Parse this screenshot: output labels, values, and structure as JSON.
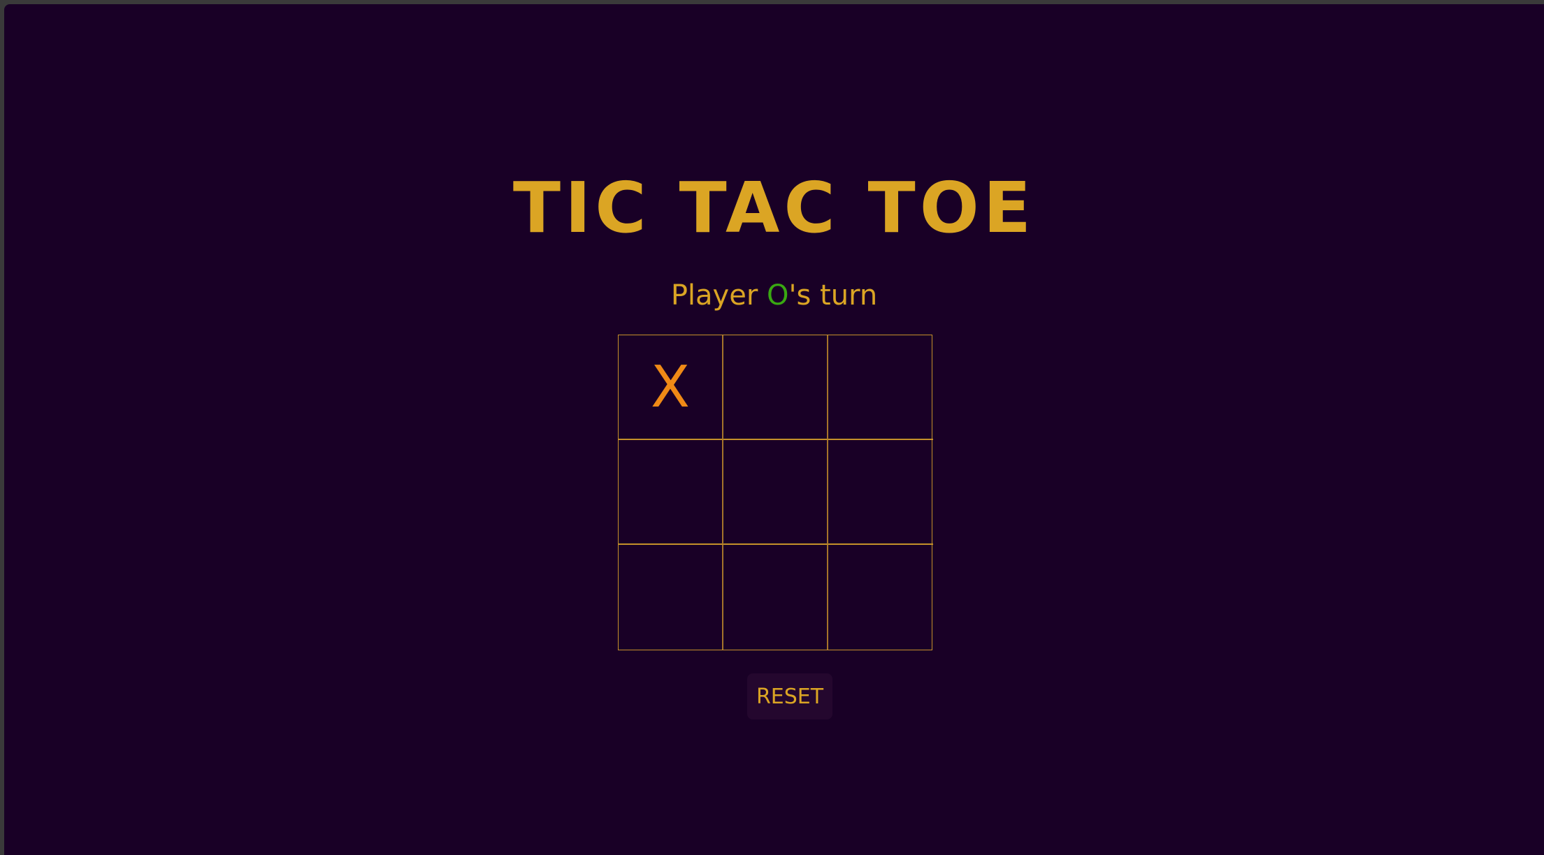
{
  "game": {
    "title": "TIC TAC TOE",
    "status": {
      "prefix": "Player ",
      "player": "O",
      "suffix": "'s turn"
    },
    "board": [
      "X",
      "",
      "",
      "",
      "",
      "",
      "",
      "",
      ""
    ],
    "reset_label": "RESET"
  },
  "colors": {
    "background": "#190026",
    "accent": "#dba524",
    "player_o": "#39a812",
    "player_x": "#ef8a16"
  }
}
